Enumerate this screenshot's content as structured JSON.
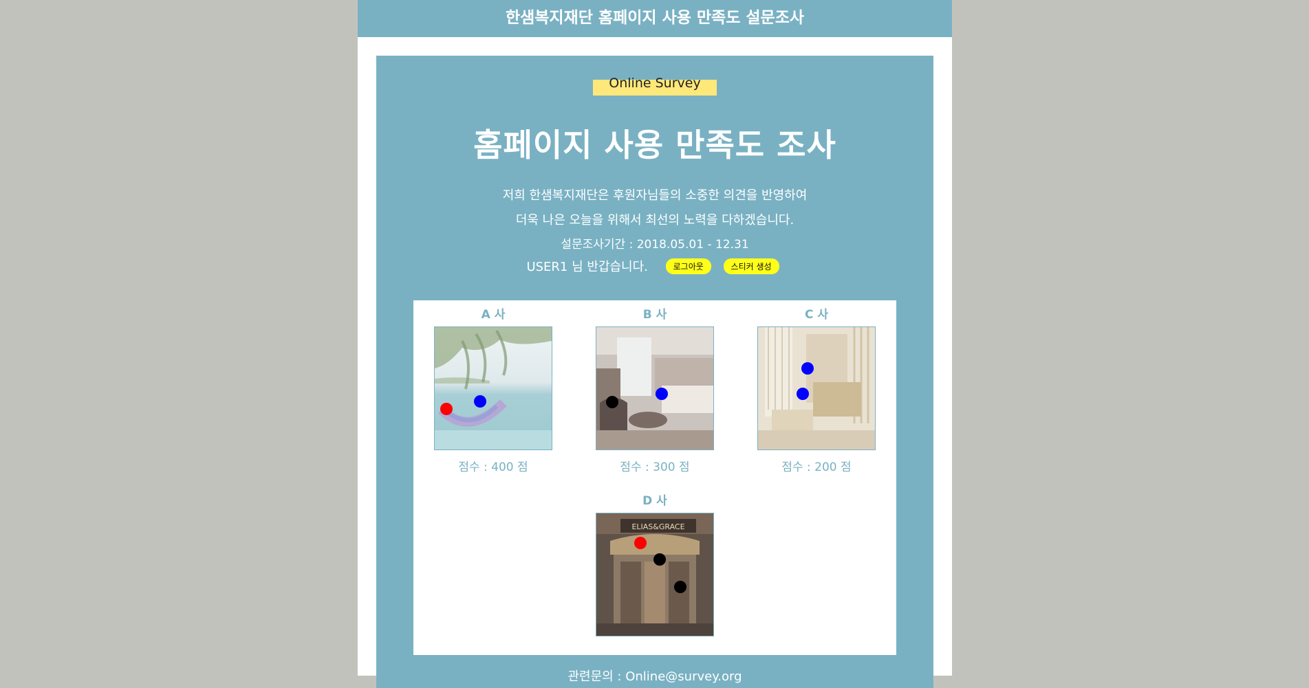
{
  "header": {
    "title": "한샘복지재단 홈페이지 사용 만족도 설문조사"
  },
  "survey": {
    "badge": "Online Survey",
    "title": "홈페이지 사용 만족도 조사",
    "intro_line1": "저희 한샘복지재단은 후원자님들의 소중한 의견을 반영하여",
    "intro_line2": "더욱 나은 오늘을 위해서 최선의 노력을 다하겠습니다.",
    "period": "설문조사기간 : 2018.05.01 - 12.31",
    "greeting": "USER1 님 반갑습니다.",
    "logout_label": "로그아웃",
    "sticker_label": "스티커 생성"
  },
  "companies": [
    {
      "name": "A 사",
      "score_text": "점수 : 400 점",
      "photo": "beach-hammock-photo"
    },
    {
      "name": "B 사",
      "score_text": "점수 : 300 점",
      "photo": "hotel-room-photo"
    },
    {
      "name": "C 사",
      "score_text": "점수 : 200 점",
      "photo": "luxury-interior-photo"
    },
    {
      "name": "D 사",
      "score_text": "",
      "photo": "storefront-photo"
    }
  ],
  "sticker_colors": {
    "red": "#ff0000",
    "blue": "#0000ff",
    "black": "#000000"
  },
  "footer": {
    "contact": "관련문의 : Online@survey.org"
  },
  "colors": {
    "accent": "#79b1c3",
    "badge": "#ffe87a",
    "button": "#ffff19",
    "background": "#c2c2bd"
  }
}
